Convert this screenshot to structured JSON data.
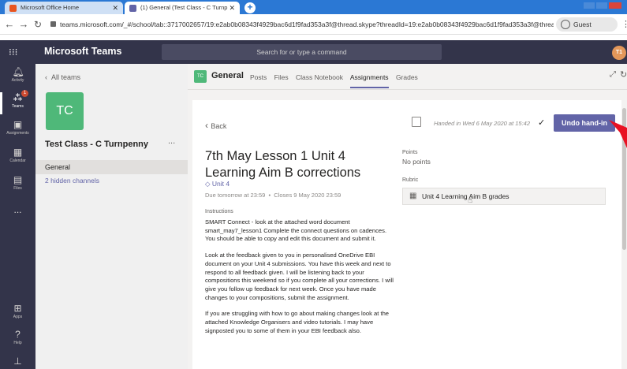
{
  "browser": {
    "tabs": [
      {
        "title": "Microsoft Office Home",
        "active": false
      },
      {
        "title": "(1) General (Test Class - C Turnp",
        "active": true
      }
    ],
    "new_tab_label": "+",
    "url": "teams.microsoft.com/_#/school/tab::3717002657/19:e2ab0b08343f4929bac6d1f9fad353a3f@thread.skype?threadId=19:e2ab0b08343f4929bac6d1f9fad353a3f@thread.skype&...",
    "profile_label": "Guest"
  },
  "teams_header": {
    "app_name": "Microsoft Teams",
    "search_placeholder": "Search for or type a command",
    "avatar_initials": "T1"
  },
  "rail": {
    "items": [
      {
        "label": "Activity",
        "icon": "bell-icon"
      },
      {
        "label": "Teams",
        "icon": "teams-icon",
        "badge": "1"
      },
      {
        "label": "Assignments",
        "icon": "assignments-icon"
      },
      {
        "label": "Calendar",
        "icon": "calendar-icon"
      },
      {
        "label": "Files",
        "icon": "files-icon"
      },
      {
        "label": "...",
        "icon": "more-icon"
      }
    ],
    "bottom_items": [
      {
        "label": "Apps",
        "icon": "apps-icon"
      },
      {
        "label": "Help",
        "icon": "help-icon"
      }
    ]
  },
  "team_panel": {
    "back_label": "All teams",
    "team_initials": "TC",
    "team_name": "Test Class - C Turnpenny",
    "more_label": "...",
    "channels": [
      {
        "label": "General"
      },
      {
        "label": "2 hidden channels"
      }
    ]
  },
  "channel": {
    "avatar": "TC",
    "name": "General",
    "tabs": [
      "Posts",
      "Files",
      "Class Notebook",
      "Assignments",
      "Grades"
    ],
    "active_tab": "Assignments"
  },
  "assignment": {
    "back_label": "Back",
    "handed_in_text": "Handed in Wed 6 May 2020 at 15:42",
    "undo_button": "Undo hand-in",
    "title": "7th May Lesson 1 Unit 4 Learning Aim B corrections",
    "category": "Unit 4",
    "due": "Due tomorrow at 23:59",
    "closes": "Closes 9 May 2020 23:59",
    "instructions_label": "Instructions",
    "paragraphs": [
      "SMART Connect - look at the attached word document smart_may7_lesson1  Complete the connect questions on cadences.  You should be able to copy and edit this document and submit it.",
      "Look at the feedback given to you in personalised OneDrive EBI document on your Unit 4 submissions.  You have this week and next to respond to all feedback given.  I will be listening back to your compositions this weekend so if you complete all your corrections. I will give you follow up feedback for next week.  Once you have made changes to your compositions, submit the assignment.",
      "If you are struggling with how to go about making changes look at the attached Knowledge Organisers and video tutorials.  I may have signposted you to some of them in your EBI feedback also."
    ],
    "points_label": "Points",
    "points_value": "No points",
    "rubric_label": "Rubric",
    "rubric_item": "Unit 4 Learning Aim B grades"
  },
  "colors": {
    "teams_purple": "#6264a7",
    "header_bg": "#33344a",
    "browser_blue": "#2b78d4",
    "annotation_arrow": "#e81123"
  }
}
